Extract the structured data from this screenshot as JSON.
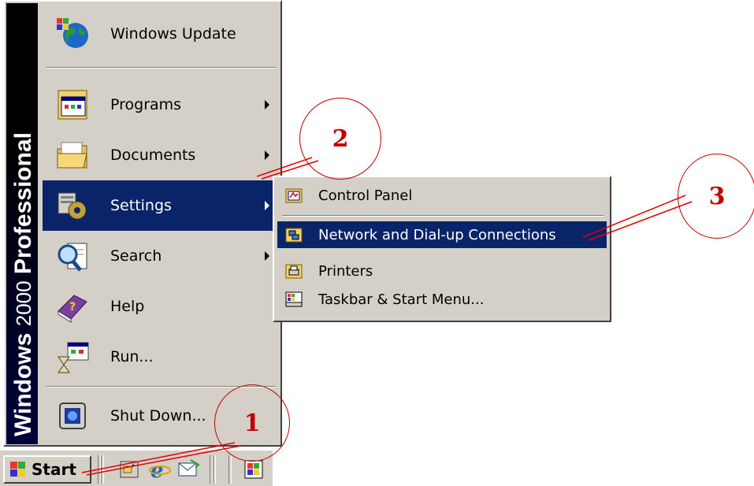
{
  "banner": {
    "word1": "Windows",
    "word2": "2000",
    "word3": "Professional"
  },
  "menu": {
    "items": [
      {
        "label": "Windows Update",
        "icon": "globe-update-icon",
        "submenu": false
      },
      {
        "label": "Programs",
        "icon": "programs-folder-icon",
        "submenu": true
      },
      {
        "label": "Documents",
        "icon": "documents-folder-icon",
        "submenu": true
      },
      {
        "label": "Settings",
        "icon": "settings-gear-icon",
        "submenu": true,
        "selected": true
      },
      {
        "label": "Search",
        "icon": "search-magnifier-icon",
        "submenu": true
      },
      {
        "label": "Help",
        "icon": "help-book-icon",
        "submenu": false
      },
      {
        "label": "Run...",
        "icon": "run-hourglass-icon",
        "submenu": false
      },
      {
        "label": "Shut Down...",
        "icon": "shutdown-icon",
        "submenu": false
      }
    ]
  },
  "submenu": {
    "items": [
      {
        "label": "Control Panel",
        "icon": "control-panel-folder-icon"
      },
      {
        "label": "Network and Dial-up Connections",
        "icon": "network-folder-icon",
        "selected": true
      },
      {
        "label": "Printers",
        "icon": "printers-folder-icon"
      },
      {
        "label": "Taskbar & Start Menu...",
        "icon": "taskbar-icon"
      }
    ]
  },
  "taskbar": {
    "start_label": "Start",
    "quicklaunch": [
      "show-desktop-icon",
      "internet-explorer-icon",
      "outlook-express-icon"
    ]
  },
  "callouts": [
    "1",
    "2",
    "3"
  ],
  "colors": {
    "menu_bg": "#d4d0c8",
    "selection": "#0a246a",
    "callout": "#c00000",
    "banner": "#000000"
  }
}
